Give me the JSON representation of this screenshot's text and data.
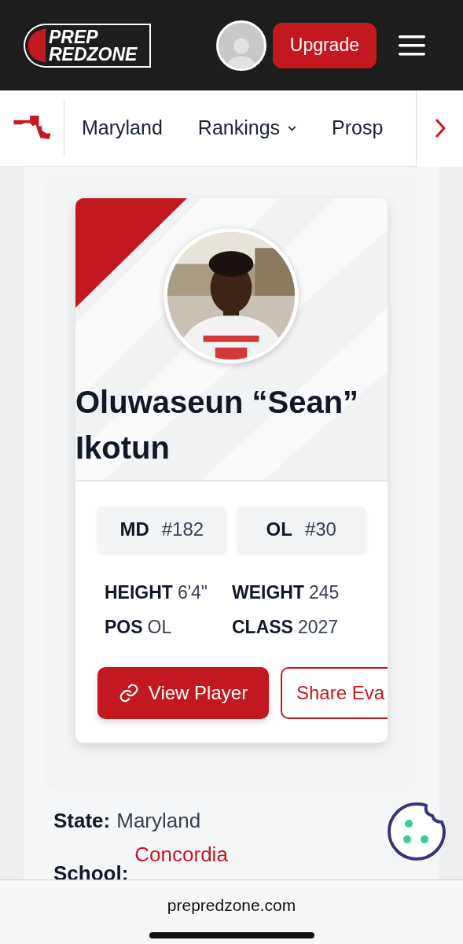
{
  "header": {
    "logo": {
      "line1": "PREP",
      "line2": "REDZONE"
    },
    "upgrade_button": "Upgrade"
  },
  "nav": {
    "items": [
      {
        "label": "Maryland",
        "has_dropdown": false
      },
      {
        "label": "Rankings",
        "has_dropdown": true
      },
      {
        "label": "Prosp",
        "has_dropdown": false
      }
    ]
  },
  "player": {
    "name": "Oluwaseun “Sean” Ikotun",
    "ranks": [
      {
        "label": "MD",
        "value": "#182"
      },
      {
        "label": "OL",
        "value": "#30"
      }
    ],
    "stats": [
      {
        "label": "HEIGHT",
        "value": "6'4\""
      },
      {
        "label": "WEIGHT",
        "value": "245"
      },
      {
        "label": "POS",
        "value": "OL"
      },
      {
        "label": "CLASS",
        "value": "2027"
      }
    ],
    "buttons": [
      {
        "kind": "primary",
        "label": "View Player"
      },
      {
        "kind": "outline",
        "label": "Share Eva"
      }
    ]
  },
  "details": [
    {
      "kind": "text",
      "label": "State:",
      "value": "Maryland"
    },
    {
      "kind": "link",
      "label": "School:",
      "value": "Concordia"
    }
  ],
  "browser": {
    "url": "prepredzone.com"
  }
}
